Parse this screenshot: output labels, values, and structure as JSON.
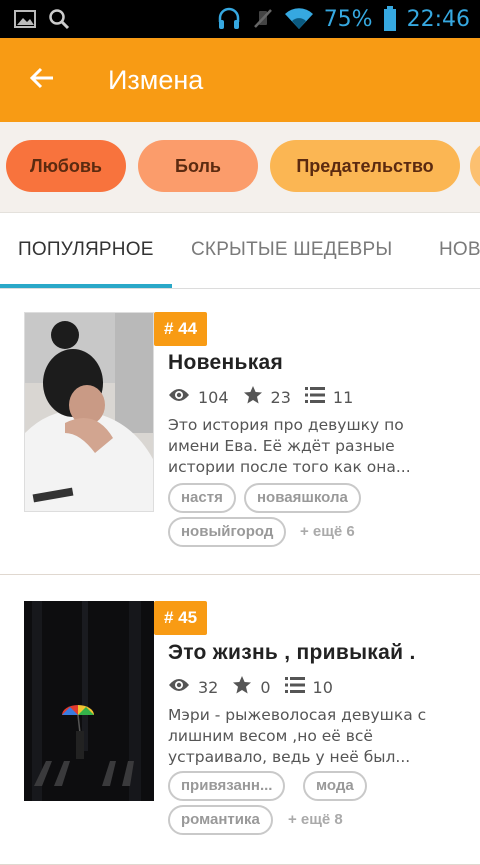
{
  "status_bar": {
    "battery": "75%",
    "time": "22:46",
    "icons": [
      "gallery-icon",
      "search-icon",
      "headset-icon",
      "mute-icon",
      "wifi-icon",
      "battery-icon"
    ]
  },
  "toolbar": {
    "back_icon": "arrow-left-icon",
    "title": "Измена"
  },
  "chips": [
    {
      "label": "Любовь",
      "color": "#f8733d"
    },
    {
      "label": "Боль",
      "color": "#fb9c6b"
    },
    {
      "label": "Предательство",
      "color": "#fbb653"
    },
    {
      "label": "",
      "color": "#fcc070"
    }
  ],
  "tabs": {
    "items": [
      "ПОПУЛЯРНОЕ",
      "СКРЫТЫЕ ШЕДЕВРЫ",
      "НОВ"
    ],
    "active": "ПОПУЛЯРНОЕ",
    "indicator_color": "#2aa8c8"
  },
  "stories": [
    {
      "rank": "# 44",
      "title": "Новенькая",
      "views": "104",
      "votes": "23",
      "parts": "11",
      "description_lines": [
        "Это история про девушку по",
        "имени Ева. Её ждёт разные",
        "истории после того как она..."
      ],
      "tags": [
        "настя",
        "новаяшкола",
        "новыйгород"
      ],
      "more_tags": "+ ещё 6"
    },
    {
      "rank": "# 45",
      "title": "Это жизнь , привыкай .",
      "views": "32",
      "votes": "0",
      "parts": "10",
      "description_lines": [
        "Мэри - рыжеволосая девушка с",
        "лишним весом ,но её всё",
        "устраивало, ведь у неё был..."
      ],
      "tags": [
        "привязанн...",
        "мода",
        "романтика"
      ],
      "more_tags": "+ ещё 8"
    }
  ],
  "colors": {
    "accent": "#f89b14",
    "status_bar_text": "#36a8e0"
  }
}
